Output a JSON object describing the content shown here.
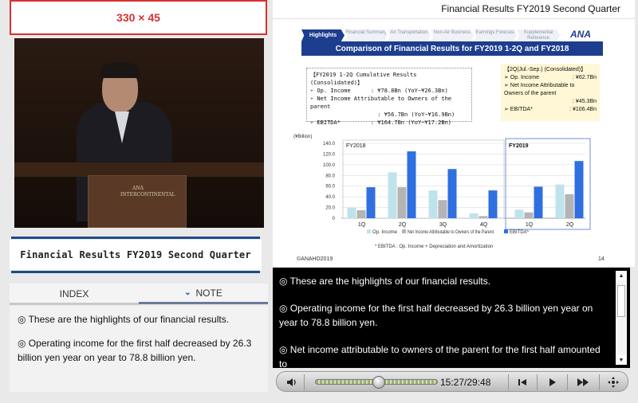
{
  "ad": {
    "text": "330 × 45"
  },
  "video": {
    "podium_logo": "ANA INTERCONTINENTAL"
  },
  "left_panel": {
    "title": "Financial Results FY2019 Second Quarter",
    "tabs": [
      {
        "label": "INDEX"
      },
      {
        "label": "NOTE"
      }
    ],
    "notes": [
      "◎ These are the highlights of our financial results.",
      "◎ Operating income for the first half decreased by 26.3 billion yen year on year to 78.8 billion yen."
    ]
  },
  "slide": {
    "header_title": "Financial Results FY2019 Second Quarter",
    "nav_tabs": [
      "Highlights",
      "Financial Summary",
      "Air Transportation",
      "Non-Air Business",
      "Earnings Forecast",
      "Supplemental Reference"
    ],
    "logo": "ANA",
    "title": "Comparison of Financial Results for FY2019 1-2Q and FY2018",
    "box1": {
      "heading": "【FY2019 1-2Q Cumulative Results (Consolidated)】",
      "line1": "➢ Op. Income      : ¥78.8Bn (YoY−¥26.3Bn)",
      "line2": "➢ Net Income Attributable to Owners of the parent",
      "line3": "                    : ¥56.7Bn (YoY−¥16.9Bn)",
      "line4": "➢ EBITDA*         : ¥164.7Bn (YoY−¥17.2Bn)"
    },
    "box2": {
      "heading": "【2Q(Jul.-Sep.) (Consolidated)】",
      "op_label": "➢ Op. Income",
      "op_value": ": ¥62.7Bn",
      "ni_label": "➢ Net Income Attributable to Owners of the parent",
      "ni_value": ": ¥45.3Bn",
      "eb_label": "➢ EBITDA*",
      "eb_value": ": ¥106.4Bn"
    },
    "footnote": "* EBITDA : Op. Income + Depreciation and Amortization",
    "copyright": "©ANAHD2019",
    "page_number": "14"
  },
  "chart_data": {
    "type": "bar",
    "ylabel": "(¥Billion)",
    "ylim": [
      0,
      140
    ],
    "yticks": [
      "0",
      "20.0",
      "40.0",
      "60.0",
      "80.0",
      "100.0",
      "120.0",
      "140.0"
    ],
    "groups": [
      {
        "label": "FY2018",
        "categories": [
          "1Q",
          "2Q",
          "3Q",
          "4Q"
        ]
      },
      {
        "label": "FY2019",
        "categories": [
          "1Q",
          "2Q"
        ]
      }
    ],
    "categories": [
      "1Q",
      "2Q",
      "3Q",
      "4Q",
      "1Q",
      "2Q"
    ],
    "series": [
      {
        "name": "Op. Income",
        "color": "#bfe3ec",
        "values": [
          20,
          86,
          52,
          9,
          16,
          63
        ]
      },
      {
        "name": "Net Income Attributable to Owners of the Parent",
        "color": "#b4b4b4",
        "values": [
          15,
          58,
          34,
          4,
          11,
          45
        ]
      },
      {
        "name": "EBITDA*",
        "color": "#2f6fe0",
        "values": [
          58,
          125,
          92,
          52,
          59,
          107
        ]
      }
    ]
  },
  "caption": {
    "lines": [
      "◎ These are the highlights of our financial results.",
      "◎ Operating income for the first half decreased by 26.3 billion yen year on year to 78.8 billion yen.",
      "◎ Net income attributable to owners of the parent for the first half amounted to"
    ]
  },
  "player": {
    "time": "15:27/29:48",
    "progress": 0.52
  }
}
